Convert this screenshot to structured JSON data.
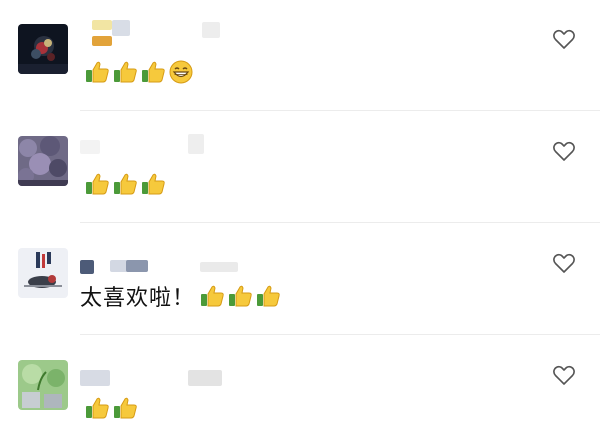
{
  "comments": [
    {
      "text": "",
      "reactions": [
        "thumbs-up-icon",
        "thumbs-up-icon",
        "thumbs-up-icon",
        "grinning-face-icon"
      ]
    },
    {
      "text": "",
      "reactions": [
        "thumbs-up-icon",
        "thumbs-up-icon",
        "thumbs-up-icon"
      ]
    },
    {
      "text": "太喜欢啦！",
      "reactions": [
        "thumbs-up-icon",
        "thumbs-up-icon",
        "thumbs-up-icon"
      ]
    },
    {
      "text": "",
      "reactions": [
        "thumbs-up-icon",
        "thumbs-up-icon"
      ]
    }
  ],
  "colors": {
    "background": "#ffffff",
    "divider": "#ececec",
    "text": "#111111",
    "like_outline": "#555555"
  }
}
